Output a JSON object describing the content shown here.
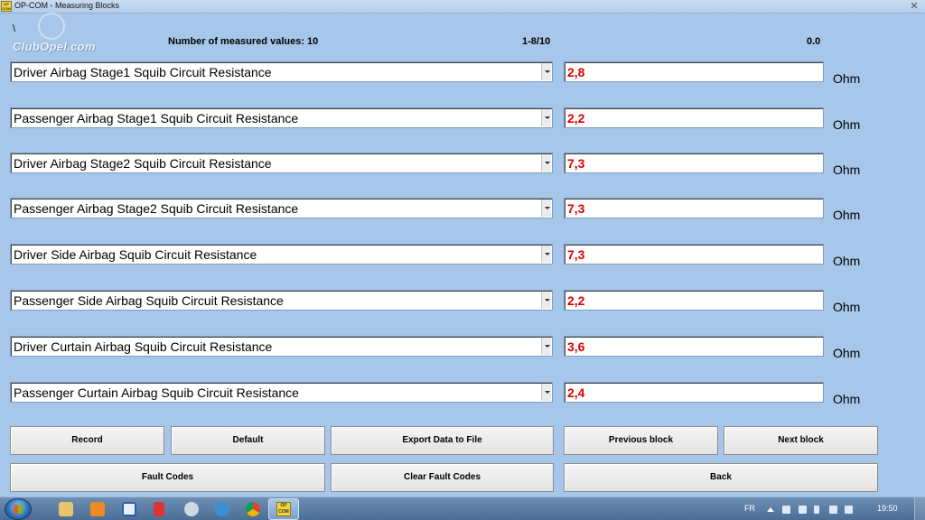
{
  "window": {
    "title": "OP-COM - Measuring Blocks",
    "app_icon_text": "OP COM",
    "close_label": "✕"
  },
  "header": {
    "backslash": "\\",
    "logo": "ClubOpel.com",
    "measured_values": "Number of measured values: 10",
    "range": "1-8/10",
    "time": "0.0"
  },
  "rows": [
    {
      "label": "Driver Airbag Stage1 Squib Circuit Resistance",
      "value": "2,8",
      "unit": "Ohm"
    },
    {
      "label": "Passenger Airbag Stage1 Squib Circuit Resistance",
      "value": "2,2",
      "unit": "Ohm"
    },
    {
      "label": "Driver Airbag Stage2 Squib Circuit Resistance",
      "value": "7,3",
      "unit": "Ohm"
    },
    {
      "label": "Passenger Airbag Stage2 Squib Circuit Resistance",
      "value": "7,3",
      "unit": "Ohm"
    },
    {
      "label": "Driver Side Airbag Squib Circuit Resistance",
      "value": "7,3",
      "unit": "Ohm"
    },
    {
      "label": "Passenger Side Airbag Squib Circuit Resistance",
      "value": "2,2",
      "unit": "Ohm"
    },
    {
      "label": "Driver Curtain Airbag Squib Circuit Resistance",
      "value": "3,6",
      "unit": "Ohm"
    },
    {
      "label": "Passenger Curtain Airbag Squib Circuit Resistance",
      "value": "2,4",
      "unit": "Ohm"
    }
  ],
  "buttons": {
    "record": "Record",
    "default": "Default",
    "export": "Export Data to File",
    "previous": "Previous block",
    "next": "Next block",
    "fault_codes": "Fault Codes",
    "clear_fault_codes": "Clear Fault Codes",
    "back": "Back"
  },
  "taskbar": {
    "active_app_icon_text": "OP COM",
    "language": "FR",
    "time": "19:50",
    "icons": [
      "start-orb-icon",
      "file-explorer-icon",
      "media-player-icon",
      "security-icon",
      "pin-icon",
      "globe-icon",
      "internet-explorer-icon",
      "chrome-icon",
      "op-com-icon"
    ]
  },
  "colors": {
    "background": "#a7c7ea",
    "value_text": "#e00000"
  }
}
